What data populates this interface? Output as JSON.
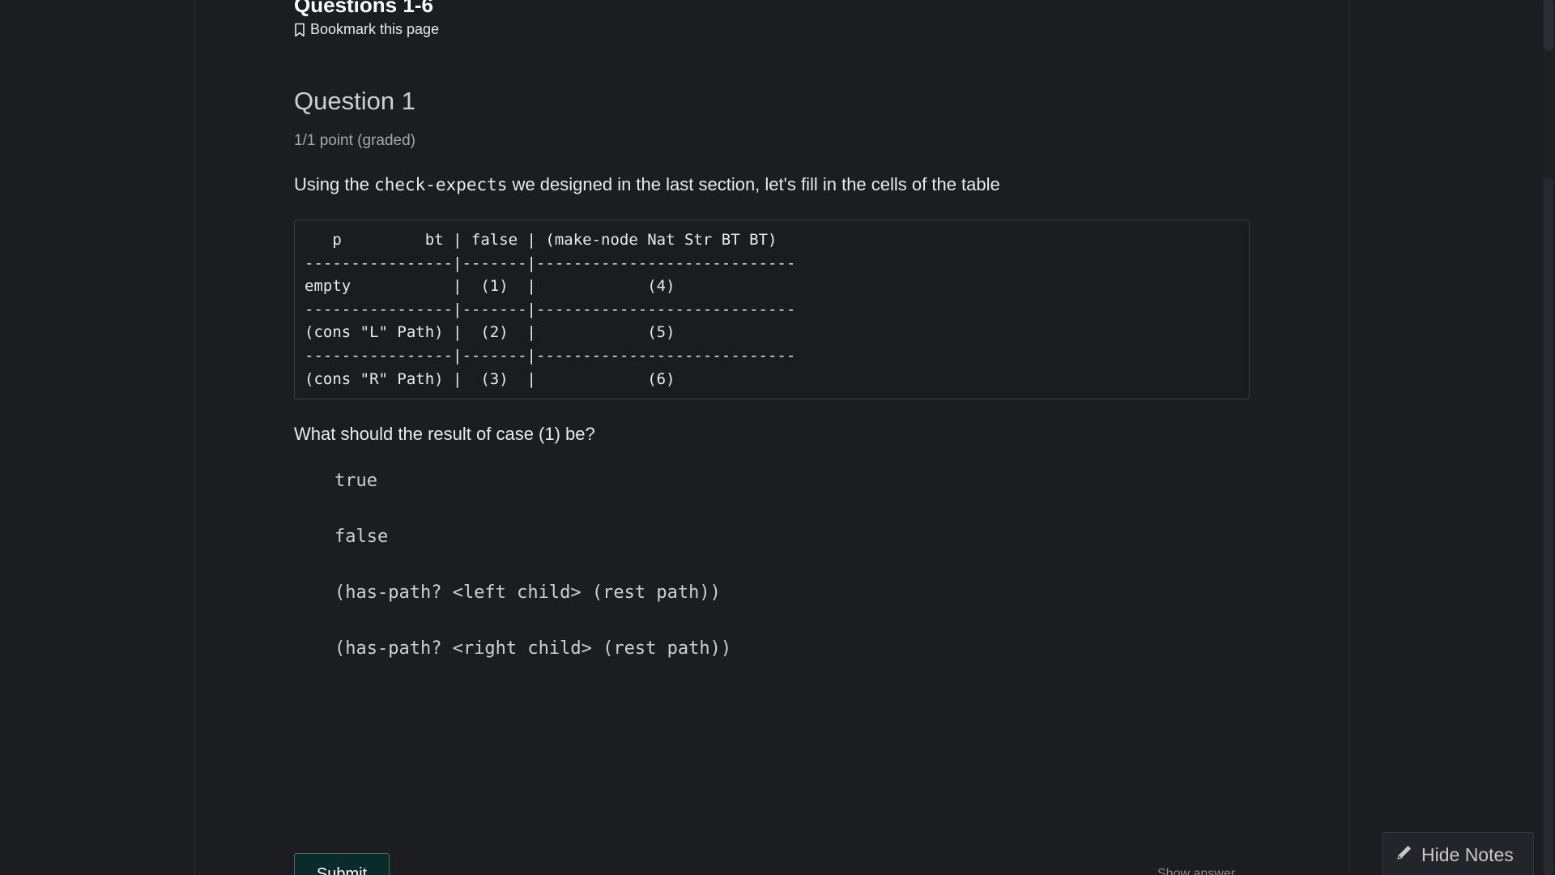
{
  "unit": {
    "title": "Questions 1-6",
    "bookmark_label": "Bookmark this page"
  },
  "question": {
    "title": "Question 1",
    "points": "1/1 point (graded)",
    "prompt_before": "Using the ",
    "prompt_code": "check-expects",
    "prompt_after": " we designed in the last section, let's fill in the cells of the table",
    "table_lines": [
      "   p         bt | false | (make-node Nat Str BT BT)",
      "----------------|-------|----------------------------",
      "empty           |  (1)  |            (4)",
      "----------------|-------|----------------------------",
      "(cons \"L\" Path) |  (2)  |            (5)",
      "----------------|-------|----------------------------",
      "(cons \"R\" Path) |  (3)  |            (6)"
    ],
    "ask": "What should the result of case (1) be?",
    "choices": [
      "true",
      "false",
      "(has-path? <left child> (rest path))",
      "(has-path? <right child> (rest path))"
    ]
  },
  "actions": {
    "submit_label": "Submit",
    "show_answer_label": "Show answer",
    "hide_notes_label": "Hide Notes"
  }
}
